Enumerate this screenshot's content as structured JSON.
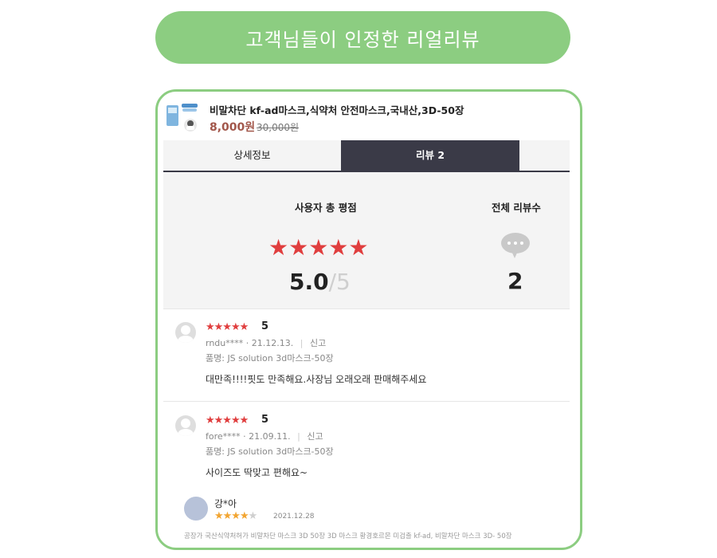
{
  "banner": {
    "title": "고객님들이 인정한 리얼리뷰"
  },
  "product": {
    "name": "비말차단 kf-ad마스크,식약처 안전마스크,국내산,3D-50장",
    "price": "8,000원",
    "original_price": "30,000원"
  },
  "tabs": [
    {
      "label": "상세정보",
      "active": false
    },
    {
      "label": "리뷰 2",
      "active": true
    }
  ],
  "summary": {
    "rating_title": "사용자 총 평점",
    "count_title": "전체 리뷰수",
    "stars": "★★★★★",
    "score": "5.0",
    "score_max": "/5",
    "review_count": "2"
  },
  "reviews": [
    {
      "stars": "★★★★★",
      "rating": "5",
      "user": "rndu****",
      "date": "· 21.12.13.",
      "sep": "|",
      "report": "신고",
      "product": "품명: JS solution 3d마스크-50장",
      "text": "대만족!!!!핏도 만족해요.사장님 오래오래 판매해주세요"
    },
    {
      "stars": "★★★★★",
      "rating": "5",
      "user": "fore****",
      "date": "· 21.09.11.",
      "sep": "|",
      "report": "신고",
      "product": "품명: JS solution 3d마스크-50장",
      "text": "사이즈도 딱맞고 편해요~"
    }
  ],
  "extra_review": {
    "user": "강*아",
    "stars_on": "★★★★",
    "stars_off": "★",
    "date": "2021.12.28",
    "text": "공장가 국산식약처허가 비말차단 마스크 3D 50장 3D 마스크 황경호르몬 미검출 kf-ad, 비말차단 마스크 3D- 50장"
  },
  "colors": {
    "accent_green": "#8ccd81",
    "star_red": "#e03e3e",
    "star_orange": "#f2a531",
    "tab_dark": "#3a3a47",
    "price": "#a2574b"
  }
}
